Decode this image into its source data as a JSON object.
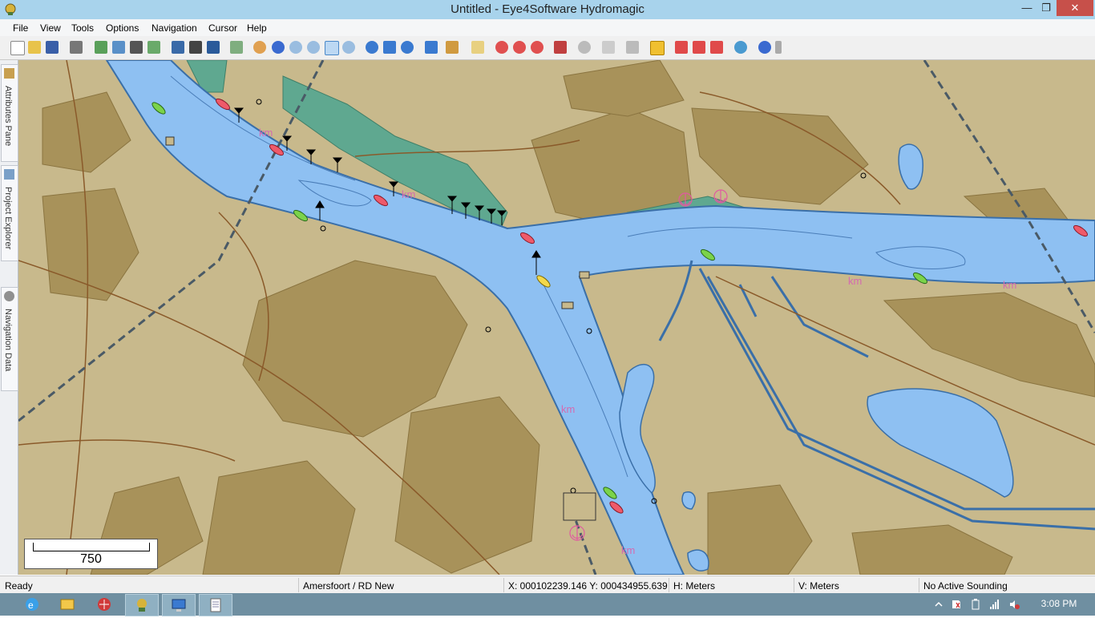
{
  "window": {
    "title": "Untitled - Eye4Software Hydromagic"
  },
  "menu": [
    "File",
    "View",
    "Tools",
    "Options",
    "Navigation",
    "Cursor",
    "Help"
  ],
  "side_tabs": [
    "Attributes Pane",
    "Project Explorer",
    "Navigation Data"
  ],
  "map": {
    "labels": [
      "km",
      "km",
      "km",
      "km",
      "km",
      "km"
    ],
    "scale": "750"
  },
  "status": {
    "state": "Ready",
    "projection": "Amersfoort / RD New",
    "coords": "X: 000102239.146  Y: 000434955.639",
    "h_units": "H: Meters",
    "v_units": "V: Meters",
    "sounding": "No Active Sounding"
  },
  "taskbar": {
    "clock": "3:08 PM"
  },
  "colors": {
    "water": "#8ec0f2",
    "land": "#c8b98c",
    "land_dark": "#a8925a",
    "title_bar": "#a8d3ec"
  }
}
